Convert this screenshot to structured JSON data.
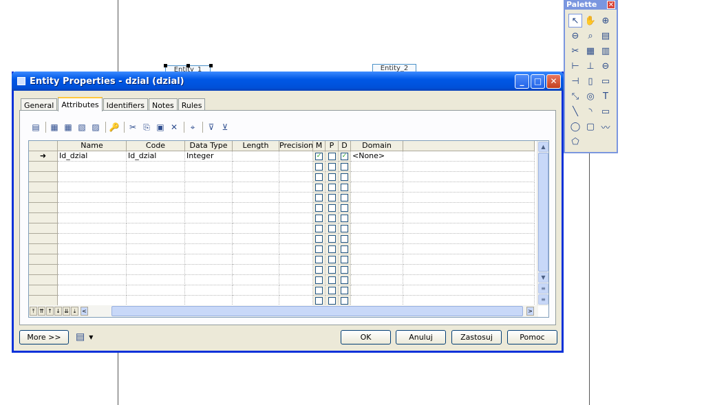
{
  "background": {
    "entity_top_left_label": "Entity_1",
    "entity_top_right_label": "Entity_2"
  },
  "palette": {
    "title": "Palette",
    "close_glyph": "✕",
    "tools": [
      {
        "name": "pointer-icon",
        "glyph": "↖",
        "active": true
      },
      {
        "name": "grabber-hand-icon",
        "glyph": "✋"
      },
      {
        "name": "zoom-in-icon",
        "glyph": "⊕"
      },
      {
        "name": "zoom-out-icon",
        "glyph": "⊖"
      },
      {
        "name": "open-package-icon",
        "glyph": "⌕"
      },
      {
        "name": "properties-icon",
        "glyph": "▤"
      },
      {
        "name": "cut-icon",
        "glyph": "✂"
      },
      {
        "name": "entity-icon",
        "glyph": "▦"
      },
      {
        "name": "table-icon",
        "glyph": "▥"
      },
      {
        "name": "relationship-icon",
        "glyph": "⊢"
      },
      {
        "name": "inheritance-icon",
        "glyph": "⊥"
      },
      {
        "name": "association-icon",
        "glyph": "⊖"
      },
      {
        "name": "association-link-icon",
        "glyph": "⊣"
      },
      {
        "name": "file-icon",
        "glyph": "▯"
      },
      {
        "name": "note-icon",
        "glyph": "▭"
      },
      {
        "name": "link-icon",
        "glyph": "⤡"
      },
      {
        "name": "cylinder-icon",
        "glyph": "◎"
      },
      {
        "name": "text-icon",
        "glyph": "T"
      },
      {
        "name": "line-icon",
        "glyph": "╲"
      },
      {
        "name": "arc-icon",
        "glyph": "◝"
      },
      {
        "name": "rectangle-icon",
        "glyph": "▭"
      },
      {
        "name": "ellipse-icon",
        "glyph": "◯"
      },
      {
        "name": "rounded-rectangle-icon",
        "glyph": "▢"
      },
      {
        "name": "polyline-icon",
        "glyph": "〰"
      },
      {
        "name": "polygon-icon",
        "glyph": "⬠"
      }
    ]
  },
  "dialog": {
    "title": "Entity Properties - dzial (dzial)",
    "minimize_glyph": "_",
    "maximize_glyph": "□",
    "close_glyph": "✕",
    "tabs": [
      {
        "label": "General",
        "active": false
      },
      {
        "label": "Attributes",
        "active": true
      },
      {
        "label": "Identifiers",
        "active": false
      },
      {
        "label": "Notes",
        "active": false
      },
      {
        "label": "Rules",
        "active": false
      }
    ],
    "toolbar": [
      {
        "name": "properties-icon",
        "glyph": "▤"
      },
      {
        "sep": true
      },
      {
        "name": "add-row-icon",
        "glyph": "▦"
      },
      {
        "name": "insert-row-icon",
        "glyph": "▦"
      },
      {
        "name": "add-attributes-icon",
        "glyph": "▧"
      },
      {
        "name": "replicate-attributes-icon",
        "glyph": "▨"
      },
      {
        "sep": true
      },
      {
        "name": "key-icon",
        "glyph": "🔑"
      },
      {
        "sep": true
      },
      {
        "name": "cut-icon",
        "glyph": "✂"
      },
      {
        "name": "copy-icon",
        "glyph": "⎘"
      },
      {
        "name": "paste-icon",
        "glyph": "▣"
      },
      {
        "name": "delete-icon",
        "glyph": "✕"
      },
      {
        "sep": true
      },
      {
        "name": "find-icon",
        "glyph": "⌖"
      },
      {
        "sep": true
      },
      {
        "name": "filter-icon",
        "glyph": "⊽"
      },
      {
        "name": "filter-options-icon",
        "glyph": "⊻"
      }
    ],
    "columns": [
      {
        "label": "",
        "key": "rowhead"
      },
      {
        "label": "Name",
        "key": "name"
      },
      {
        "label": "Code",
        "key": "code"
      },
      {
        "label": "Data Type",
        "key": "dtype"
      },
      {
        "label": "Length",
        "key": "length"
      },
      {
        "label": "Precision",
        "key": "precision"
      },
      {
        "label": "M",
        "key": "m"
      },
      {
        "label": "P",
        "key": "p"
      },
      {
        "label": "D",
        "key": "d"
      },
      {
        "label": "Domain",
        "key": "domain"
      },
      {
        "label": "",
        "key": "filler"
      }
    ],
    "rows": [
      {
        "rowhead": "➜",
        "name": "Id_dzial",
        "code": "Id_dzial",
        "dtype": "Integer",
        "length": "",
        "precision": "",
        "m": true,
        "p": false,
        "d": true,
        "domain": "<None>"
      }
    ],
    "empty_row_count": 15,
    "check_glyph": "✓",
    "nav_glyphs": [
      "⤒",
      "⇈",
      "↑",
      "↓",
      "⇊",
      "⤓"
    ],
    "scroll_glyphs": {
      "up": "▲",
      "down": "▼",
      "left": "<",
      "right": ">",
      "grip": "≡",
      "hgrip": "|||"
    },
    "buttons": {
      "more": "More >>",
      "ok": "OK",
      "cancel": "Anuluj",
      "apply": "Zastosuj",
      "help": "Pomoc"
    },
    "print_menu_glyph": "▼"
  },
  "colors": {
    "titlebar": "#0058e6",
    "dialog_face": "#ece9d8",
    "check_green": "#21a121"
  }
}
